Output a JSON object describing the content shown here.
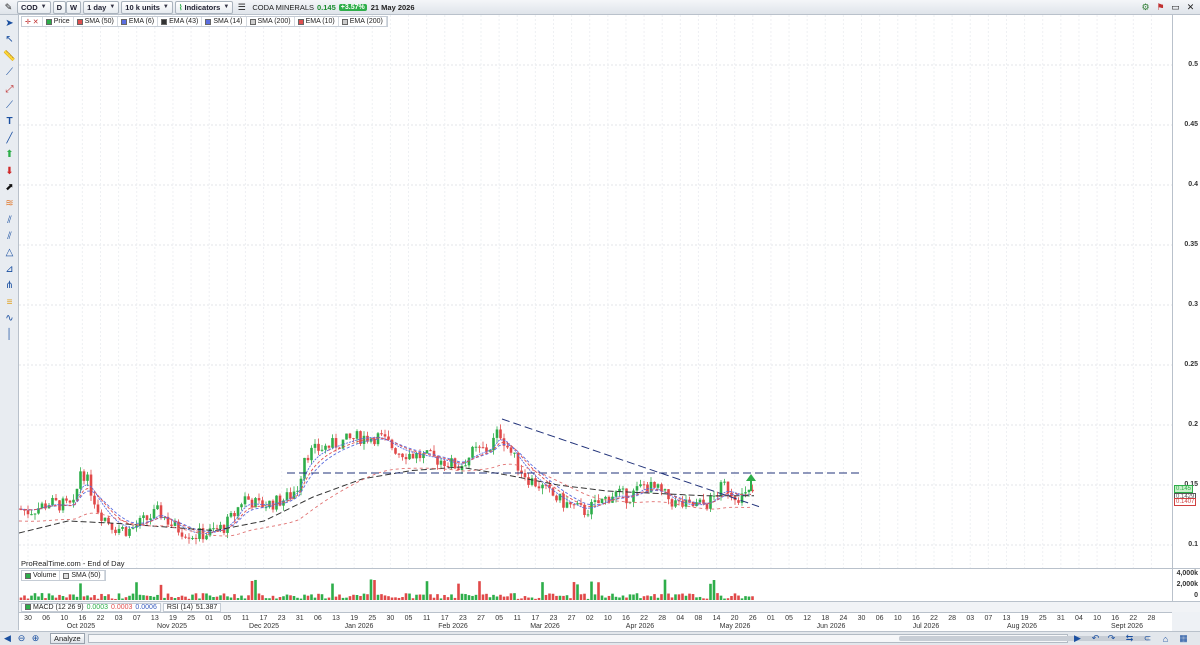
{
  "toolbar": {
    "symbol": "COD",
    "period_d": "D",
    "period_w": "W",
    "interval": "1 day",
    "units": "10 k units",
    "indicators_label": "Indicators",
    "instrument_name": "CODA MINERALS",
    "last_price": "0.145",
    "change_pct": "+3.57%",
    "date": "21 May 2026"
  },
  "legend": [
    {
      "label": "Price",
      "color": "#2eae4a"
    },
    {
      "label": "SMA (50)",
      "color": "#e05050"
    },
    {
      "label": "EMA (6)",
      "color": "#5b6ee0"
    },
    {
      "label": "EMA (43)",
      "color": "#333333"
    },
    {
      "label": "SMA (14)",
      "color": "#5b6ee0"
    },
    {
      "label": "SMA (200)",
      "color": "#cccccc"
    },
    {
      "label": "EMA (10)",
      "color": "#e05050"
    },
    {
      "label": "EMA (200)",
      "color": "#cccccc"
    }
  ],
  "footer_note": "ProRealTime.com - End of Day",
  "price_axis": {
    "ticks": [
      "0.5",
      "0.45",
      "0.4",
      "0.35",
      "0.3",
      "0.25",
      "0.2",
      "0.15",
      "0.1"
    ],
    "tag_last": "0.145",
    "tag_ma1": "0.1429",
    "tag_ma2": "0.1407"
  },
  "volume": {
    "legend_volume": "Volume",
    "legend_sma": "SMA (50)",
    "axis_top": "4,000k",
    "axis_mid": "2,000k",
    "axis_zero": "0"
  },
  "indicators": {
    "macd_label": "MACD (12 26 9)",
    "macd_v1": "0.0003",
    "macd_v2": "0.0003",
    "macd_v3": "0.0006",
    "rsi_label": "RSI (14)",
    "rsi_value": "51.387"
  },
  "time_axis": {
    "days": [
      "30",
      "06",
      "10",
      "16",
      "22",
      "03",
      "07",
      "13",
      "19",
      "25",
      "01",
      "05",
      "11",
      "17",
      "23",
      "31",
      "06",
      "13",
      "19",
      "25",
      "30",
      "05",
      "11",
      "17",
      "23",
      "27",
      "05",
      "11",
      "17",
      "23",
      "27",
      "02",
      "10",
      "16",
      "22",
      "28",
      "04",
      "08",
      "14",
      "20",
      "26",
      "01",
      "05",
      "12",
      "18",
      "24",
      "30",
      "06",
      "10",
      "16",
      "22",
      "28",
      "03",
      "07",
      "13",
      "19",
      "25",
      "31",
      "04",
      "10",
      "16",
      "22",
      "28"
    ],
    "months": [
      "Oct 2025",
      "Nov 2025",
      "Dec 2025",
      "Jan 2026",
      "Feb 2026",
      "Mar 2026",
      "Apr 2026",
      "May 2026",
      "Jun 2026",
      "Jul 2026",
      "Aug 2026",
      "Sept 2026"
    ]
  },
  "bottom": {
    "analyze_label": "Analyze"
  },
  "chart_data": {
    "type": "line",
    "title": "CODA MINERALS",
    "ylim": [
      0.09,
      0.53
    ],
    "x": [
      "2025-09-30",
      "2025-10-15",
      "2025-11-01",
      "2025-11-15",
      "2025-12-01",
      "2025-12-15",
      "2026-01-01",
      "2026-01-15",
      "2026-02-01",
      "2026-02-15",
      "2026-03-01",
      "2026-03-15",
      "2026-04-01",
      "2026-04-15",
      "2026-05-01",
      "2026-05-21"
    ],
    "series": [
      {
        "name": "Price",
        "values": [
          0.13,
          0.14,
          0.105,
          0.115,
          0.11,
          0.135,
          0.18,
          0.185,
          0.17,
          0.175,
          0.15,
          0.13,
          0.135,
          0.145,
          0.14,
          0.145
        ]
      },
      {
        "name": "EMA (43)",
        "values": [
          0.11,
          0.12,
          0.118,
          0.115,
          0.112,
          0.12,
          0.14,
          0.155,
          0.162,
          0.165,
          0.158,
          0.15,
          0.145,
          0.143,
          0.141,
          0.141
        ]
      }
    ]
  }
}
